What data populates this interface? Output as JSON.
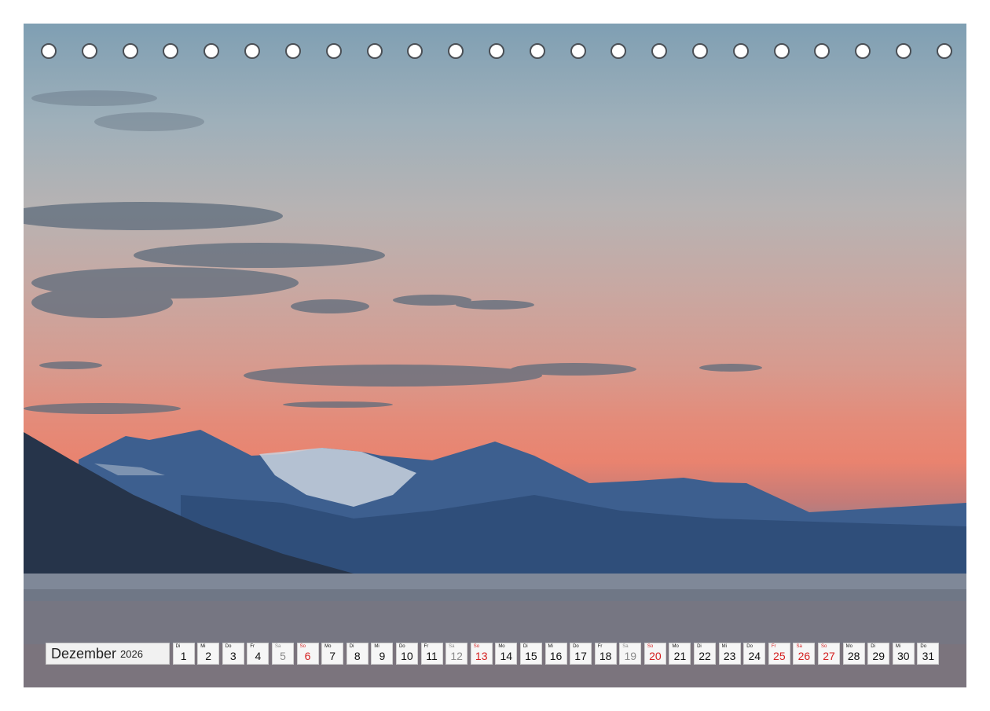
{
  "calendar": {
    "month": "Dezember",
    "year": "2026",
    "days": [
      {
        "wd": "Di",
        "num": "1",
        "kind": "weekday"
      },
      {
        "wd": "Mi",
        "num": "2",
        "kind": "weekday"
      },
      {
        "wd": "Do",
        "num": "3",
        "kind": "weekday"
      },
      {
        "wd": "Fr",
        "num": "4",
        "kind": "weekday"
      },
      {
        "wd": "Sa",
        "num": "5",
        "kind": "sat"
      },
      {
        "wd": "So",
        "num": "6",
        "kind": "sun"
      },
      {
        "wd": "Mo",
        "num": "7",
        "kind": "weekday"
      },
      {
        "wd": "Di",
        "num": "8",
        "kind": "weekday"
      },
      {
        "wd": "Mi",
        "num": "9",
        "kind": "weekday"
      },
      {
        "wd": "Do",
        "num": "10",
        "kind": "weekday"
      },
      {
        "wd": "Fr",
        "num": "11",
        "kind": "weekday"
      },
      {
        "wd": "Sa",
        "num": "12",
        "kind": "sat"
      },
      {
        "wd": "So",
        "num": "13",
        "kind": "sun"
      },
      {
        "wd": "Mo",
        "num": "14",
        "kind": "weekday"
      },
      {
        "wd": "Di",
        "num": "15",
        "kind": "weekday"
      },
      {
        "wd": "Mi",
        "num": "16",
        "kind": "weekday"
      },
      {
        "wd": "Do",
        "num": "17",
        "kind": "weekday"
      },
      {
        "wd": "Fr",
        "num": "18",
        "kind": "weekday"
      },
      {
        "wd": "Sa",
        "num": "19",
        "kind": "sat"
      },
      {
        "wd": "So",
        "num": "20",
        "kind": "sun"
      },
      {
        "wd": "Mo",
        "num": "21",
        "kind": "weekday"
      },
      {
        "wd": "Di",
        "num": "22",
        "kind": "weekday"
      },
      {
        "wd": "Mi",
        "num": "23",
        "kind": "weekday"
      },
      {
        "wd": "Do",
        "num": "24",
        "kind": "weekday"
      },
      {
        "wd": "Fr",
        "num": "25",
        "kind": "hol"
      },
      {
        "wd": "Sa",
        "num": "26",
        "kind": "hol"
      },
      {
        "wd": "So",
        "num": "27",
        "kind": "sun"
      },
      {
        "wd": "Mo",
        "num": "28",
        "kind": "weekday"
      },
      {
        "wd": "Di",
        "num": "29",
        "kind": "weekday"
      },
      {
        "wd": "Mi",
        "num": "30",
        "kind": "weekday"
      },
      {
        "wd": "Do",
        "num": "31",
        "kind": "weekday"
      }
    ]
  },
  "colors": {
    "sunday_red": "#d42020",
    "saturday_gray": "#8a8a8a"
  }
}
